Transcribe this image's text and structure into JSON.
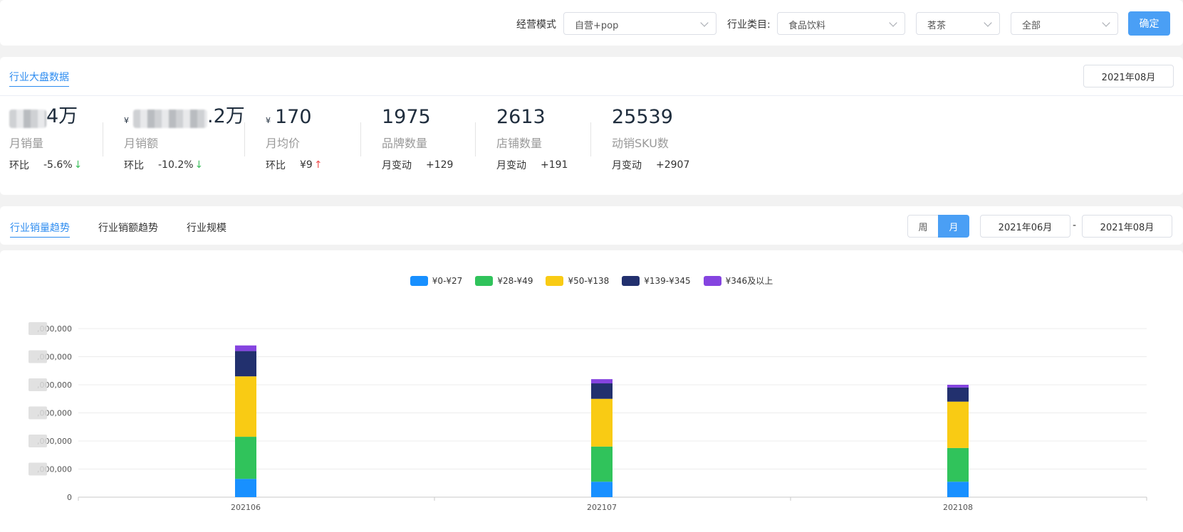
{
  "filter": {
    "mode_label": "经营模式",
    "mode_value": "自营+pop",
    "category_label": "行业类目:",
    "category_l1": "食品饮料",
    "category_l2": "茗茶",
    "category_l3": "全部",
    "confirm": "确定"
  },
  "overview": {
    "tab": "行业大盘数据",
    "date": "2021年08月",
    "currency": "¥",
    "metrics": [
      {
        "value_suffix": "4万",
        "name": "月销量",
        "change_label": "环比",
        "change": "-5.6%",
        "dir": "down"
      },
      {
        "value_suffix": ".2万",
        "name": "月销额",
        "change_label": "环比",
        "change": "-10.2%",
        "dir": "down"
      },
      {
        "value": "170",
        "name": "月均价",
        "change_label": "环比",
        "change": "¥9",
        "dir": "up"
      },
      {
        "value": "1975",
        "name": "品牌数量",
        "change_label": "月变动",
        "change": "+129"
      },
      {
        "value": "2613",
        "name": "店铺数量",
        "change_label": "月变动",
        "change": "+191"
      },
      {
        "value": "25539",
        "name": "动销SKU数",
        "change_label": "月变动",
        "change": "+2907"
      }
    ]
  },
  "trend": {
    "tabs": [
      "行业销量趋势",
      "行业销额趋势",
      "行业规模"
    ],
    "active_tab": 0,
    "period_week": "周",
    "period_month": "月",
    "date_from": "2021年06月",
    "date_sep": "-",
    "date_to": "2021年08月"
  },
  "chart_data": {
    "type": "bar",
    "stacked": true,
    "categories": [
      "202106",
      "202107",
      "202108"
    ],
    "ytick_labels": [
      "0",
      ",000,000",
      ",000,000",
      ",000,000",
      ",000,000",
      ",000,000",
      ",000,000"
    ],
    "ylim_relative": [
      0,
      6
    ],
    "series": [
      {
        "name": "¥0-¥27",
        "color": "#1890ff",
        "values": [
          0.65,
          0.55,
          0.55
        ]
      },
      {
        "name": "¥28-¥49",
        "color": "#30c35b",
        "values": [
          1.5,
          1.25,
          1.2
        ]
      },
      {
        "name": "¥50-¥138",
        "color": "#f9cb14",
        "values": [
          2.15,
          1.7,
          1.65
        ]
      },
      {
        "name": "¥139-¥345",
        "color": "#22306e",
        "values": [
          0.9,
          0.55,
          0.5
        ]
      },
      {
        "name": "¥346及以上",
        "color": "#8544e0",
        "values": [
          0.2,
          0.15,
          0.1
        ]
      }
    ],
    "grid": true,
    "legend_position": "top-center"
  }
}
